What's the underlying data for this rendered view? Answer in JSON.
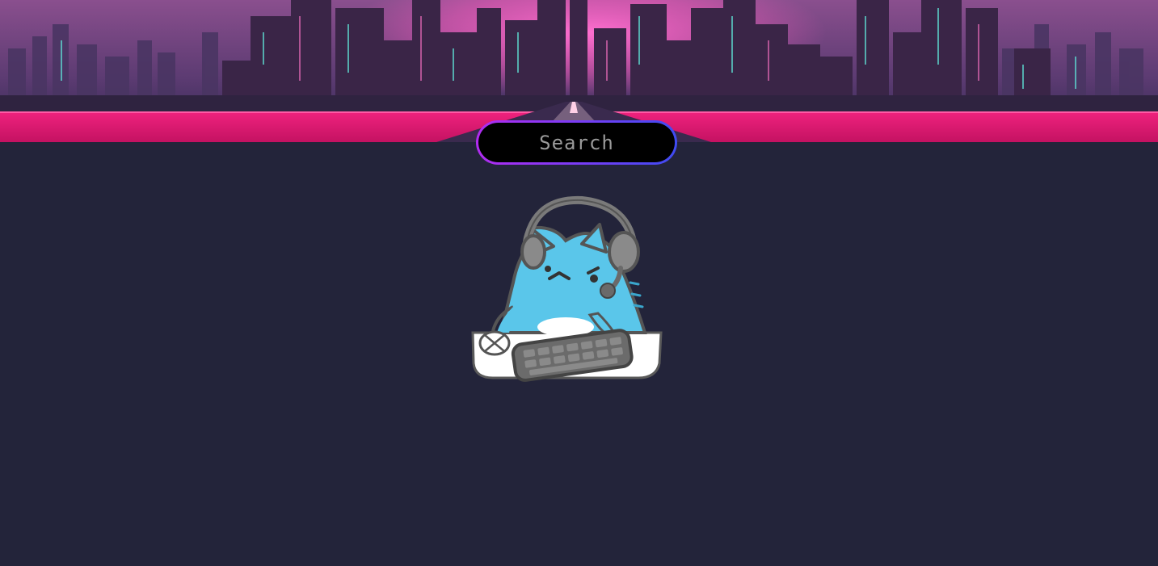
{
  "search": {
    "placeholder": "Search",
    "value": ""
  },
  "banner": {
    "icon": "synthwave-city-banner",
    "colors": {
      "sky_top": "#6d3e78",
      "glow": "#ff4fb8",
      "buildings": "#3a2547",
      "road": "#e11a74"
    }
  },
  "mascot": {
    "icon": "gamer-cat-mascot",
    "colors": {
      "body": "#5ac6ea",
      "headset": "#8a8a8a",
      "keyboard": "#6b6b6b",
      "desk": "#ffffff"
    }
  },
  "theme": {
    "background": "#23243a",
    "search_border_start": "#b12cf0",
    "search_border_end": "#3f4bf2"
  }
}
